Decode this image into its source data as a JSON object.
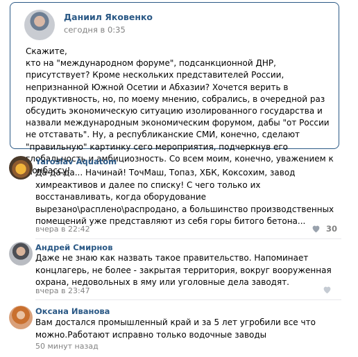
{
  "post": {
    "author": "Даниил Яковенко",
    "time": "сегодня в 0:35",
    "lines": [
      "Скажите,",
      "кто на \"международном форуме\", подсанкционной ДНР, присутствует? Кроме нескольких представителей России, непризнанной Южной Осетии и Абхазии? Хочется верить в продуктивность, но, по моему мнению, собрались, в очередной раз обсудить экономическую ситуацию изолированного государства и назвали международным экономическим форумом, дабы \"от России не отставать\". Ну, а республиканские СМИ, конечно, сделают \"правильную\" картинку сего мероприятия, подчеркнув его глобальность и амбициозность. Со всем моим, конечно, уважением к Донбассу!"
    ]
  },
  "comments": [
    {
      "author": "Yaroslav Aquatom",
      "text": "Да-да-да... Начинай! ТочМаш, Топаз, ХБК, Коксохим, завод химреактивов и далее по списку! С чего только их восстанавливать, когда оборудование вырезано\\расплено\\распродано, а большинство производственных помещений уже представляют из себя горы битого бетона...",
      "time": "вчера в 22:42",
      "likes": "30"
    },
    {
      "author": "Андрей Смирнов",
      "text": "Даже не знаю как назвать такое правительство. Напоминает концлагерь, не более - закрытая территория, вокруг вооруженная охрана, недовольных в яму или уголовные дела заводят.",
      "time": "вчера в 23:47",
      "likes": ""
    },
    {
      "author": "Оксана Иванова",
      "text": "Вам достался промышленный край и за 5 лет угробили все что можно.Работают исправно только водочные заводы",
      "time": "50 минут назад",
      "likes": ""
    }
  ],
  "colors": {
    "link": "#2a5885",
    "muted": "#828282",
    "border": "#2a5885"
  },
  "icons": [
    "like-heart-icon"
  ]
}
